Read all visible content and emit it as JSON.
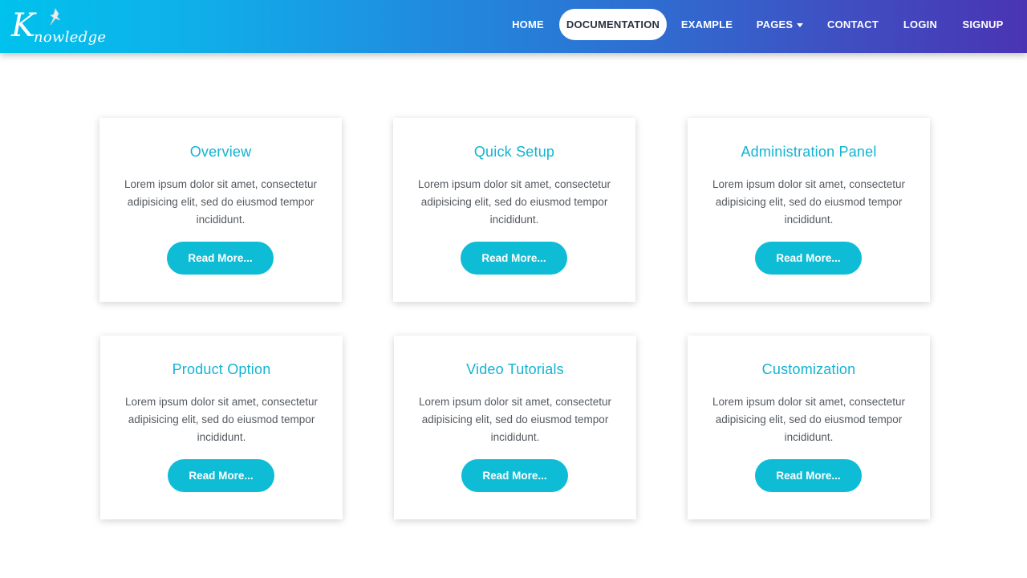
{
  "logo": {
    "first_letter": "K",
    "rest_text": "nowledge"
  },
  "nav": {
    "home": "HOME",
    "documentation": "DOCUMENTATION",
    "example": "EXAMPLE",
    "pages": "PAGES",
    "contact": "CONTACT",
    "login": "LOGIN",
    "signup": "SIGNUP"
  },
  "colors": {
    "nav_gradient_start": "#00c2ec",
    "nav_gradient_end": "#4a34b3",
    "accent": "#12b3d3",
    "button": "#0fbcd6"
  },
  "cards": [
    {
      "title": "Overview",
      "body": "Lorem ipsum dolor sit amet, consectetur adipisicing elit, sed do eiusmod tempor incididunt.",
      "button": "Read More..."
    },
    {
      "title": "Quick Setup",
      "body": "Lorem ipsum dolor sit amet, consectetur adipisicing elit, sed do eiusmod tempor incididunt.",
      "button": "Read More..."
    },
    {
      "title": "Administration Panel",
      "body": "Lorem ipsum dolor sit amet, consectetur adipisicing elit, sed do eiusmod tempor incididunt.",
      "button": "Read More..."
    },
    {
      "title": "Product Option",
      "body": "Lorem ipsum dolor sit amet, consectetur adipisicing elit, sed do eiusmod tempor incididunt.",
      "button": "Read More..."
    },
    {
      "title": "Video Tutorials",
      "body": "Lorem ipsum dolor sit amet, consectetur adipisicing elit, sed do eiusmod tempor incididunt.",
      "button": "Read More..."
    },
    {
      "title": "Customization",
      "body": "Lorem ipsum dolor sit amet, consectetur adipisicing elit, sed do eiusmod tempor incididunt.",
      "button": "Read More..."
    }
  ]
}
